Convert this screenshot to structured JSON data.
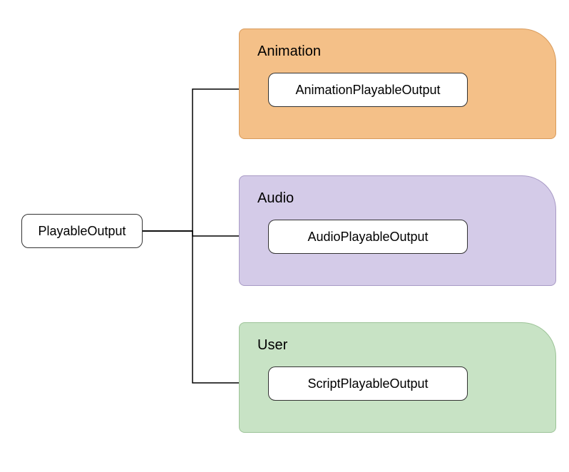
{
  "root": {
    "label": "PlayableOutput"
  },
  "groups": [
    {
      "title": "Animation",
      "child_label": "AnimationPlayableOutput",
      "color": "#f4c088"
    },
    {
      "title": "Audio",
      "child_label": "AudioPlayableOutput",
      "color": "#d4cbe8"
    },
    {
      "title": "User",
      "child_label": "ScriptPlayableOutput",
      "color": "#c8e3c5"
    }
  ]
}
